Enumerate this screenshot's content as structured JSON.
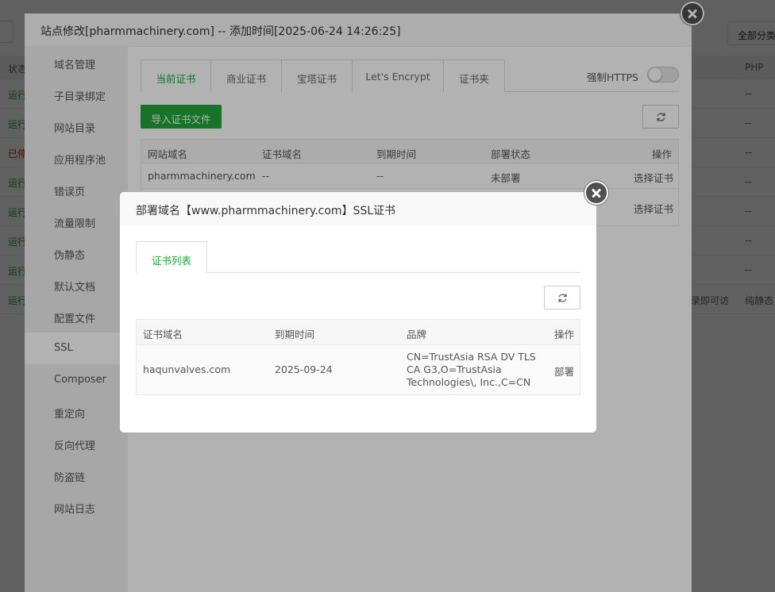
{
  "background": {
    "filter_button": "全部分类",
    "table": {
      "status_header": "状态",
      "php_header": "PHP",
      "rows": [
        {
          "status": "运行",
          "status_color": "#20a53a",
          "php": "--",
          "note": ""
        },
        {
          "status": "运行",
          "status_color": "#20a53a",
          "php": "--",
          "note": ""
        },
        {
          "status": "已停",
          "status_color": "#ef0808",
          "php": "--",
          "note": ""
        },
        {
          "status": "运行",
          "status_color": "#20a53a",
          "php": "--",
          "note": ""
        },
        {
          "status": "运行",
          "status_color": "#20a53a",
          "php": "--",
          "note": ""
        },
        {
          "status": "运行",
          "status_color": "#20a53a",
          "php": "--",
          "note": ""
        },
        {
          "status": "运行",
          "status_color": "#20a53a",
          "php": "--",
          "note": ""
        },
        {
          "status": "运行",
          "status_color": "#20a53a",
          "php": "纯静态",
          "note": "录即可访"
        }
      ]
    }
  },
  "site_dialog": {
    "title": "站点修改[pharmmachinery.com] -- 添加时间[2025-06-24 14:26:25]",
    "menu": [
      "域名管理",
      "子目录绑定",
      "网站目录",
      "应用程序池",
      "错误页",
      "流量限制",
      "伪静态",
      "默认文档",
      "配置文件",
      "SSL",
      "Composer",
      "重定向",
      "反向代理",
      "防盗链",
      "网站日志"
    ],
    "active_menu": "SSL",
    "tabs": [
      "当前证书",
      "商业证书",
      "宝塔证书",
      "Let's Encrypt",
      "证书夹"
    ],
    "force_https_label": "强制HTTPS",
    "import_button": "导入证书文件",
    "table": {
      "headers": [
        "网站域名",
        "证书域名",
        "到期时间",
        "部署状态",
        "操作"
      ],
      "rows": [
        {
          "site": "pharmmachinery.com",
          "cert": "--",
          "expire": "--",
          "status": "未部署",
          "action": "选择证书"
        },
        {
          "site": "",
          "cert": "",
          "expire": "",
          "status": "",
          "action": "选择证书"
        }
      ]
    }
  },
  "ssl_dialog": {
    "title": "部署域名【www.pharmmachinery.com】SSL证书",
    "tab": "证书列表",
    "table": {
      "headers": [
        "证书域名",
        "到期时间",
        "品牌",
        "操作"
      ],
      "rows": [
        {
          "domain": "haqunvalves.com",
          "expire": "2025-09-24",
          "brand": "CN=TrustAsia RSA DV TLS CA G3,O=TrustAsia Technologies\\, Inc.,C=CN",
          "action": "部署"
        }
      ]
    }
  },
  "colors": {
    "accent": "#20a53a",
    "danger": "#ef0808"
  }
}
